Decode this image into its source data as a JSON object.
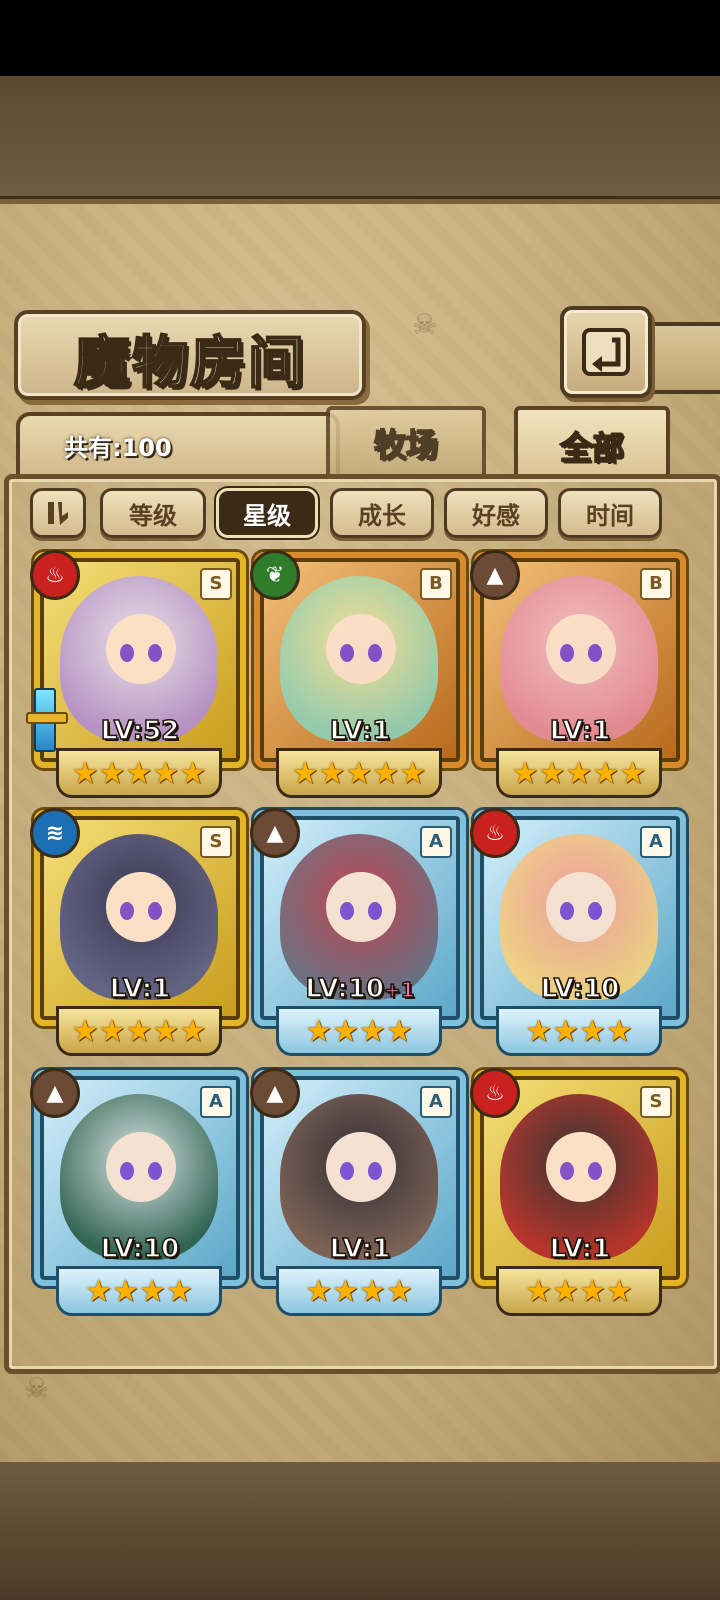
{
  "header": {
    "title": "魔物房间",
    "back_icon": "back-arrow-icon"
  },
  "tabs": [
    {
      "label": "牧场",
      "active": false
    },
    {
      "label": "全部",
      "active": true
    }
  ],
  "count_label": "共有:100",
  "sort": {
    "toggle_icon": "pause-sort-toggle-icon",
    "buttons": [
      {
        "label": "等级",
        "active": false
      },
      {
        "label": "星级",
        "active": true
      },
      {
        "label": "成长",
        "active": false
      },
      {
        "label": "好感",
        "active": false
      },
      {
        "label": "时间",
        "active": false
      }
    ]
  },
  "cards": [
    {
      "element": "fire",
      "rank": "S",
      "level": "LV:52",
      "bonus": "",
      "stars": "★★★★★",
      "weapon": true
    },
    {
      "element": "wind",
      "rank": "B",
      "level": "LV:1",
      "bonus": "",
      "stars": "★★★★★",
      "weapon": false
    },
    {
      "element": "earth",
      "rank": "B",
      "level": "LV:1",
      "bonus": "",
      "stars": "★★★★★",
      "weapon": false
    },
    {
      "element": "water",
      "rank": "S",
      "level": "LV:1",
      "bonus": "",
      "stars": "★★★★★",
      "weapon": false
    },
    {
      "element": "earth",
      "rank": "A",
      "level": "LV:10",
      "bonus": "+1",
      "stars": "★★★★",
      "weapon": false
    },
    {
      "element": "fire",
      "rank": "A",
      "level": "LV:10",
      "bonus": "",
      "stars": "★★★★",
      "weapon": false
    },
    {
      "element": "earth",
      "rank": "A",
      "level": "LV:10",
      "bonus": "",
      "stars": "★★★★",
      "weapon": false
    },
    {
      "element": "earth",
      "rank": "A",
      "level": "LV:1",
      "bonus": "",
      "stars": "★★★★",
      "weapon": false
    },
    {
      "element": "fire",
      "rank": "S",
      "level": "LV:1",
      "bonus": "",
      "stars": "★★★★",
      "weapon": false
    }
  ],
  "element_colors": {
    "fire": "#c8211e",
    "wind": "#2f7d2a",
    "earth": "#6b4a36",
    "water": "#1d6fb3"
  },
  "element_glyphs": {
    "fire": "♨",
    "wind": "❦",
    "earth": "▲",
    "water": "≋"
  },
  "portrait_colors": [
    [
      "#e9e4f2",
      "#b48fcf"
    ],
    [
      "#f7e49a",
      "#8fd0b5"
    ],
    [
      "#f2c3c8",
      "#e58a99"
    ],
    [
      "#2d2e52",
      "#5a5d8a"
    ],
    [
      "#c23a45",
      "#6a6a7a"
    ],
    [
      "#f39a9a",
      "#f5d27a"
    ],
    [
      "#dde6e3",
      "#2d5e4a"
    ],
    [
      "#2a2228",
      "#7a5a4a"
    ],
    [
      "#2a2a30",
      "#b32a2a"
    ]
  ]
}
